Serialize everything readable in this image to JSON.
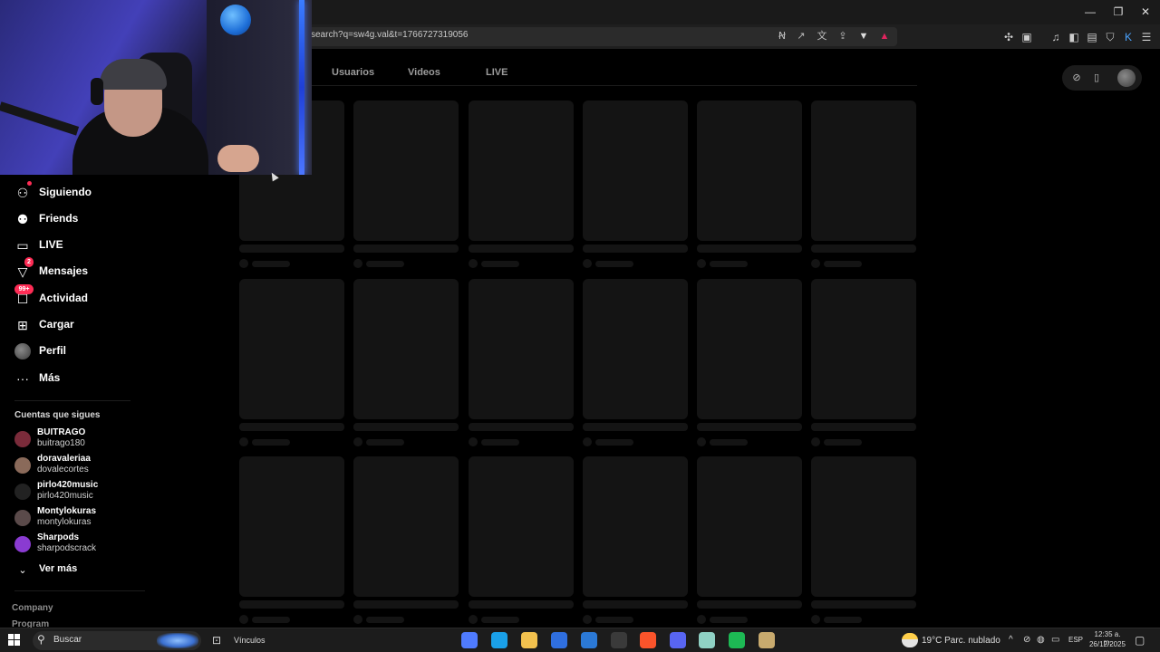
{
  "browser": {
    "url": "search?q=sw4g.val&t=1766727319056",
    "window_controls": {
      "minimize": "—",
      "maximize": "❐",
      "close": "✕"
    },
    "address_icons": [
      "reader-mode-icon",
      "open-external-icon",
      "translate-icon",
      "share-icon",
      "brave-shield-icon",
      "brave-rewards-icon"
    ],
    "toolbar_icons": [
      "extensions-icon",
      "screenshot-icon",
      "music-icon",
      "sidebar-icon",
      "wallet-icon",
      "vpn-icon",
      "extension-k-icon",
      "menu-icon"
    ]
  },
  "tabs": {
    "usuarios": "Usuarios",
    "videos": "Videos",
    "live": "LIVE"
  },
  "sidebar": {
    "items": [
      {
        "label": "Siguiendo",
        "icon": "following-icon"
      },
      {
        "label": "Friends",
        "icon": "friends-icon"
      },
      {
        "label": "LIVE",
        "icon": "live-icon"
      },
      {
        "label": "Mensajes",
        "icon": "messages-icon",
        "badge": "2"
      },
      {
        "label": "Actividad",
        "icon": "activity-icon",
        "badge": "99+"
      },
      {
        "label": "Cargar",
        "icon": "upload-icon"
      },
      {
        "label": "Perfil",
        "icon": "profile-icon"
      },
      {
        "label": "Más",
        "icon": "more-icon"
      }
    ],
    "following_title": "Cuentas que sigues",
    "following": [
      {
        "name": "BUITRAGO",
        "handle": "buitrago180",
        "color": "#7a2b3a"
      },
      {
        "name": "doravaleriaa",
        "handle": "dovalecortes",
        "color": "#8a6a5a"
      },
      {
        "name": "pirlo420music",
        "handle": "pirlo420music",
        "color": "#222222"
      },
      {
        "name": "Montylokuras",
        "handle": "montylokuras",
        "color": "#5a4a4a"
      },
      {
        "name": "Sharpods",
        "handle": "sharpodscrack",
        "color": "#8a3bd1"
      }
    ],
    "see_more": "Ver más",
    "footer": [
      "Company",
      "Program"
    ]
  },
  "taskbar": {
    "search_text": "Buscar",
    "vinculos": "Vínculos",
    "weather": "19°C  Parc. nublado",
    "lang": "ESP",
    "time": "12:35 a. m.",
    "date": "26/12/2025",
    "apps": [
      {
        "name": "copilot-icon",
        "color": "#4f7bff"
      },
      {
        "name": "edge-icon",
        "color": "#1aa0e8"
      },
      {
        "name": "file-explorer-icon",
        "color": "#f2c14e"
      },
      {
        "name": "store-icon",
        "color": "#2f6fe0"
      },
      {
        "name": "mail-icon",
        "color": "#2b79d6"
      },
      {
        "name": "obs-icon",
        "color": "#3a3a3a"
      },
      {
        "name": "brave-icon",
        "color": "#fb542b"
      },
      {
        "name": "discord-icon",
        "color": "#5865f2"
      },
      {
        "name": "notes-icon",
        "color": "#8fd1c4"
      },
      {
        "name": "spotify-icon",
        "color": "#1db954"
      },
      {
        "name": "league-icon",
        "color": "#c8aa6e"
      }
    ]
  },
  "colors": {
    "accent": "#fe2c55",
    "skeleton": "#141414",
    "background": "#000000"
  }
}
